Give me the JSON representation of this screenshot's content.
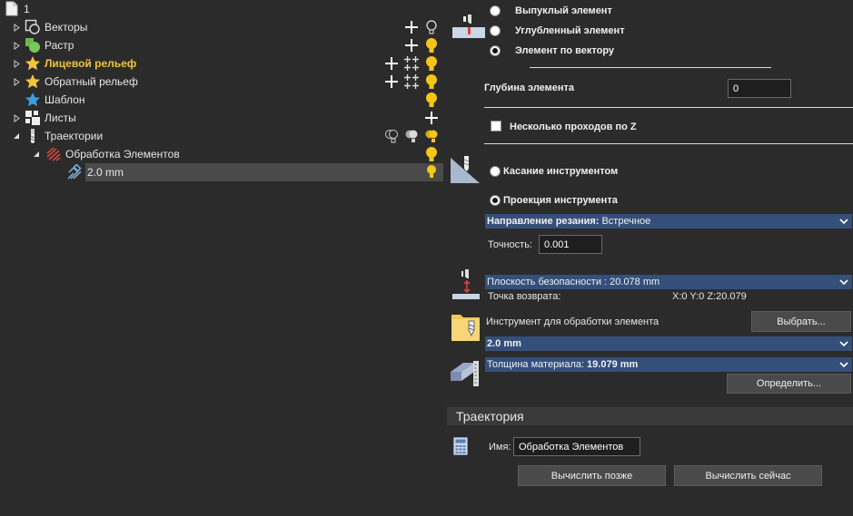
{
  "tree": {
    "root_label": "1",
    "items": [
      {
        "label": "Векторы",
        "icon": "vectors-icon",
        "has_arrow": true,
        "expanded": false
      },
      {
        "label": "Растр",
        "icon": "raster-icon",
        "has_arrow": true,
        "expanded": false
      },
      {
        "label": "Лицевой рельеф",
        "icon": "front-relief-icon",
        "has_arrow": true,
        "expanded": false,
        "highlight": true
      },
      {
        "label": "Обратный рельеф",
        "icon": "back-relief-icon",
        "has_arrow": true,
        "expanded": false
      },
      {
        "label": "Шаблон",
        "icon": "template-icon",
        "has_arrow": false
      },
      {
        "label": "Листы",
        "icon": "sheets-icon",
        "has_arrow": true,
        "expanded": false
      },
      {
        "label": "Траектории",
        "icon": "toolpaths-icon",
        "has_arrow": true,
        "expanded": true
      },
      {
        "label": "Обработка Элементов",
        "icon": "feature-machining-icon",
        "has_arrow": true,
        "expanded": true
      },
      {
        "label": "2.0 mm",
        "icon": "tool-icon",
        "has_arrow": false,
        "selected": true
      }
    ]
  },
  "panel": {
    "element_type": {
      "options": [
        "Выпуклый элемент",
        "Углубленный элемент",
        "Элемент по вектору"
      ],
      "selected": 2
    },
    "depth_label": "Глубина элемента",
    "depth_value": "0",
    "multi_pass_label": "Несколько проходов по Z",
    "tool_contact": {
      "options": [
        "Касание инструментом",
        "Проекция инструмента"
      ],
      "selected": 1
    },
    "cut_direction_label": "Направление резания:",
    "cut_direction_value": "Встречное",
    "tolerance_label": "Точность:",
    "tolerance_value": "0.001",
    "safe_plane": "Плоскость безопасности : 20.078 mm",
    "return_point_label": "Точка возврата:",
    "return_point_value": "X:0 Y:0 Z:20.079",
    "tool_label": "Инструмент для обработки элемента",
    "select_button": "Выбрать...",
    "tool_value": "2.0 mm",
    "material_label": "Толщина материала:",
    "material_value": "19.079 mm",
    "define_button": "Определить...",
    "trajectory_header": "Траектория",
    "name_label": "Имя:",
    "name_value": "Обработка Элементов",
    "calc_later": "Вычислить позже",
    "calc_now": "Вычислить сейчас"
  },
  "colors": {
    "background": "#2b2b2b",
    "dropdown": "#34507a",
    "highlight_text": "#f2c33d",
    "bulb": "#f5c518"
  }
}
